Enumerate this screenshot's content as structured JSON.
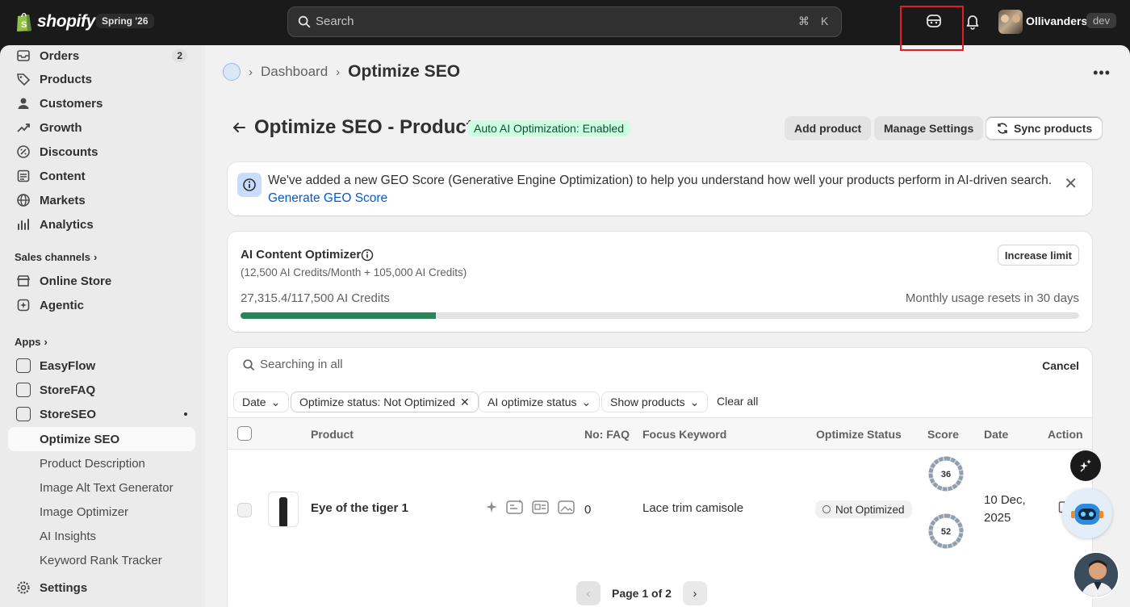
{
  "topbar": {
    "brand": "shopify",
    "edition": "Spring '26",
    "search_placeholder": "Search",
    "shortcut_cmd": "⌘",
    "shortcut_key": "K",
    "store_name": "Ollivanders",
    "env_badge": "dev"
  },
  "sidebar": {
    "orders": {
      "label": "Orders",
      "count": "2"
    },
    "items": [
      "Products",
      "Customers",
      "Growth",
      "Discounts",
      "Content",
      "Markets",
      "Analytics"
    ],
    "sales_channels_heading": "Sales channels",
    "channels": [
      "Online Store",
      "Agentic"
    ],
    "apps_heading": "Apps",
    "apps": [
      "EasyFlow",
      "StoreFAQ",
      "StoreSEO"
    ],
    "app_subnav": [
      "Optimize SEO",
      "Product Description",
      "Image Alt Text Generator",
      "Image Optimizer",
      "AI Insights",
      "Keyword Rank Tracker"
    ],
    "settings": "Settings"
  },
  "breadcrumb": {
    "link": "Dashboard",
    "current": "Optimize SEO"
  },
  "page": {
    "title": "Optimize SEO - Products",
    "auto_badge": "Auto AI Optimization: Enabled",
    "add_product": "Add product",
    "manage_settings": "Manage Settings",
    "sync_products": "Sync products"
  },
  "banner": {
    "text": "We've added a new GEO Score (Generative Engine Optimization) to help you understand how well your products perform in AI-driven search.",
    "link": "Generate GEO Score"
  },
  "ai_optimizer": {
    "title": "AI Content Optimizer",
    "subtitle": "(12,500 AI Credits/Month + 105,000 AI Credits)",
    "credits": "27,315.4/117,500 AI Credits",
    "resets": "Monthly usage resets in 30 days",
    "increase_limit": "Increase limit",
    "usage_fraction": 0.2325
  },
  "filters": {
    "search_placeholder": "Searching in all",
    "cancel": "Cancel",
    "date": "Date",
    "status_filter": "Optimize status: Not Optimized",
    "ai_status": "AI optimize status",
    "show_products": "Show products",
    "clear_all": "Clear all"
  },
  "table": {
    "headers": {
      "product": "Product",
      "faq": "No: FAQ",
      "keyword": "Focus Keyword",
      "status": "Optimize Status",
      "score": "Score",
      "date": "Date",
      "action": "Action"
    },
    "rows": [
      {
        "product": "Eye of the tiger 1",
        "faq": "0",
        "keyword": "Lace trim camisole",
        "status": "Not Optimized",
        "score_seo": "36",
        "score_geo": "52",
        "date": "10 Dec, 2025"
      }
    ]
  },
  "pagination": {
    "label": "Page 1 of 2"
  },
  "colors": {
    "accent_green": "#29845a",
    "link_blue": "#005bd3",
    "highlight_red": "#e51c23"
  }
}
